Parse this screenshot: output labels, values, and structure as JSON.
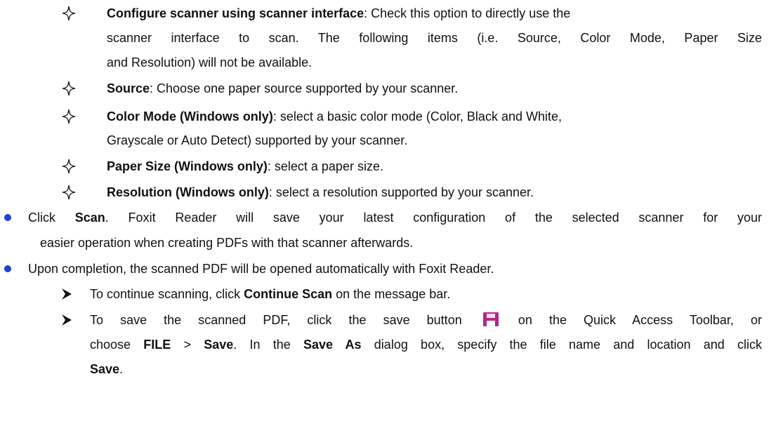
{
  "options": [
    {
      "term": "Configure scanner using scanner interface",
      "lines": [
        ": Check this option to directly use the",
        "scanner interface to scan. The following items (i.e. Source, Color Mode, Paper Size",
        "and Resolution) will not be available."
      ]
    },
    {
      "term": "Source",
      "lines": [
        ": Choose one paper source supported by your scanner."
      ]
    },
    {
      "term": "Color Mode (Windows only)",
      "lines": [
        ": select a basic color mode (Color, Black and White,",
        "Grayscale or Auto Detect) supported by your scanner."
      ]
    },
    {
      "term": "Paper Size (Windows only)",
      "lines": [
        ": select a paper size."
      ]
    },
    {
      "term": "Resolution (Windows only)",
      "lines": [
        ": select a resolution supported by your scanner."
      ]
    }
  ],
  "bullet_scan": {
    "prefix": "Click ",
    "bold": "Scan",
    "rest": ". Foxit Reader will save your latest configuration of the selected scanner for your",
    "line2": "easier operation when creating PDFs with that scanner afterwards."
  },
  "bullet_complete": {
    "text": "Upon completion, the scanned PDF will be opened automatically with Foxit Reader."
  },
  "sub_continue": {
    "prefix": "To continue scanning, click ",
    "bold": "Continue Scan",
    "rest": " on the message bar."
  },
  "sub_save": {
    "line1_prefix": "To save the scanned PDF, click the save button",
    "line1_rest": "on the Quick Access Toolbar, or",
    "line2_a": "choose ",
    "line2_b": "FILE",
    "line2_c": " > ",
    "line2_d": "Save",
    "line2_e": ". In the ",
    "line2_f": "Save As",
    "line2_g": " dialog box, specify the file name and location and click",
    "line3_bold": "Save",
    "line3_rest": "."
  },
  "colors": {
    "bullet_dot": "#1f3fd6",
    "save_icon": "#b0288c"
  },
  "icons": {
    "option_marker": "diamond-outline-icon",
    "bullet_marker": "filled-circle-icon",
    "sub_marker": "arrowhead-icon",
    "save": "floppy-disk-save-icon"
  }
}
